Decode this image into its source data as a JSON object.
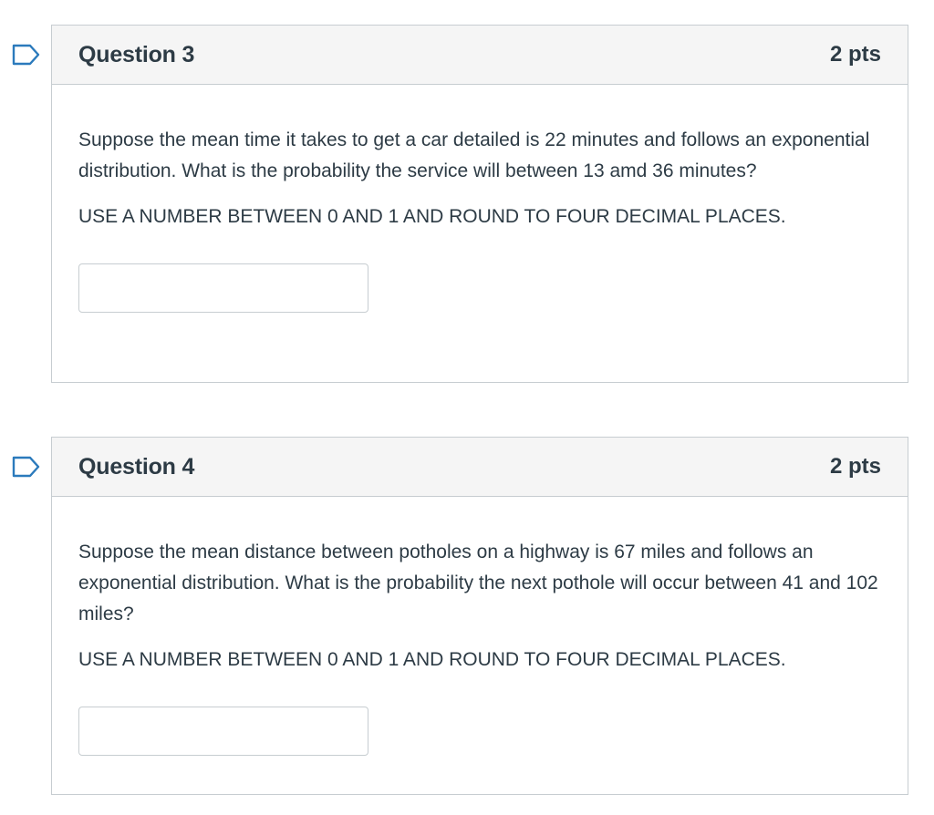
{
  "questions": [
    {
      "title": "Question 3",
      "points": "2 pts",
      "text": "Suppose the mean time it takes to get a car detailed is 22 minutes and follows an exponential distribution. What is the probability the service will between 13 amd 36 minutes?",
      "instruction": "USE A NUMBER BETWEEN 0 AND 1 AND ROUND TO FOUR DECIMAL PLACES.",
      "answer_value": "",
      "flag_icon": "bookmark-flag-icon"
    },
    {
      "title": "Question 4",
      "points": "2 pts",
      "text": "Suppose the mean distance between potholes on a highway is 67 miles and follows an exponential distribution. What is the probability the next pothole will occur between 41 and 102 miles?",
      "instruction": "USE A NUMBER BETWEEN 0 AND 1 AND ROUND TO FOUR DECIMAL PLACES.",
      "answer_value": "",
      "flag_icon": "bookmark-flag-icon"
    }
  ],
  "colors": {
    "flag": "#2b7abc",
    "header_bg": "#f5f5f5",
    "border": "#c7cdd1",
    "text": "#2d3b45"
  }
}
